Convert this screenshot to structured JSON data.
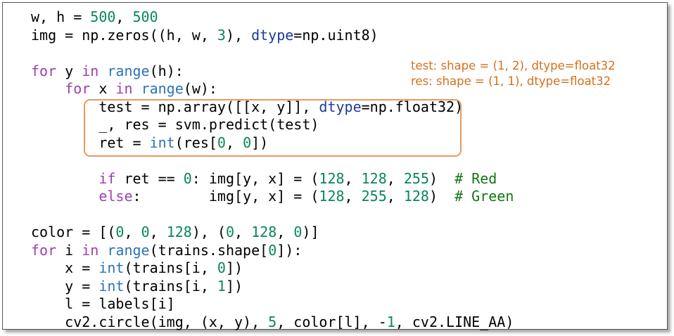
{
  "code_lines": [
    "w, h = 500, 500",
    "img = np.zeros((h, w, 3), dtype=np.uint8)",
    "",
    "for y in range(h):",
    "    for x in range(w):",
    "        test = np.array([[x, y]], dtype=np.float32)",
    "        _, res = svm.predict(test)",
    "        ret = int(res[0, 0])",
    "",
    "        if ret == 0: img[y, x] = (128, 128, 255)  # Red",
    "        else:        img[y, x] = (128, 255, 128)  # Green",
    "",
    "color = [(0, 0, 128), (0, 128, 0)]",
    "for i in range(trains.shape[0]):",
    "    x = int(trains[i, 0])",
    "    y = int(trains[i, 1])",
    "    l = labels[i]",
    "    cv2.circle(img, (x, y), 5, color[l], -1, cv2.LINE_AA)"
  ],
  "annotation": {
    "line1": "test: shape = (1, 2), dtype=float32",
    "line2": "res: shape = (1, 1), dtype=float32"
  },
  "colors": {
    "keyword": "#9c3fb0",
    "number": "#098658",
    "builtin": "#2a74b8",
    "param": "#1f3b9a",
    "comment": "#117711",
    "annotation": "#d4701c",
    "highlight_border": "#e69a5e"
  }
}
